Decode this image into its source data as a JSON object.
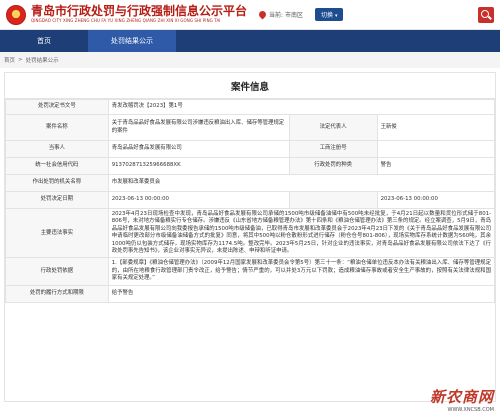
{
  "header": {
    "title": "青岛市行政处罚与行政强制信息公示平台",
    "subtitle": "QINGDAO CITY XING ZHENG CHU FA YU XING ZHENG QIANG ZHI XIN XI GONG SHI PING TAI",
    "location": "当前: 市南区",
    "switch_label": "切换"
  },
  "nav": {
    "items": [
      {
        "label": "首页"
      },
      {
        "label": "处罚结果公示"
      }
    ]
  },
  "breadcrumb": {
    "home": "首页",
    "current": "处罚结果公示"
  },
  "card": {
    "title": "案件信息",
    "labels": {
      "doc_number": "处罚决定书文号",
      "case_name": "案件名称",
      "legal_rep": "法定代表人",
      "party": "当事人",
      "business_reg": "工商注册号",
      "credit_code": "统一社会信用代码",
      "behavior_type": "行政处罚的种类",
      "authority": "作出处罚的机关名称",
      "decision_date": "处罚决定日期",
      "facts": "主要违法事实",
      "basis": "行政处罚依据",
      "fulfillment": "处罚的履行方式和期限"
    },
    "values": {
      "doc_number": "青发改稽罚决【2023】第1号",
      "case_name": "关于青岛品品好食品发展有限公司涉嫌违反粮油出入库、储存等管理规定的案件",
      "legal_rep": "王新俊",
      "party": "青岛品品好食品发展有限公司",
      "business_reg": "",
      "credit_code": "913702871325966688XK",
      "behavior_type": "警告",
      "authority": "市发展和改革委员会",
      "decision_date": "2023-06-13 00:00:00",
      "effective_date": "2023-06-13 00:00:00",
      "facts": "2023年4月23日现场检查中发现，青岛品品好食品发展有限公司承储的1500吨市级储备油储中有500吨未经批复，于4月21日起以数量和货位形式储于801-806号，未对地方储备粮实行专仓储存。涉嫌违反《山东省地方储备粮管理办法》第十四条和《粮油仓储管理办法》第三条的规定。经立案调查，5月9日，青岛品品好食品发展有限公司向我委报告承储的1500吨市级储备油，已取得青岛市发展和改革委员会于2023年4月23日下发的《关于青岛品品好食品发展有限公司申请临时更改部分市级储备油储备方式的批复》同意，将其中500吨以粉仓散粉形式进行储存（粉仓仓号801-806），现场实物库存系统计数据为560吨，其余1000吨仍以包装方式储存，现场实物库存为1174.5吨。整改完毕。2023年5月25日，针对企业的违法事实，对青岛品品好食品发展有限公司依法下达了《行政处罚事先告知书》，该企业对事实无异议，未提出陈述、申辩和听证申请。",
      "basis": "1.【部委规章】《粮油仓储管理办法》（2009年12月国家发展和改革委员会令第5号）第三十一条：“粮油仓储单位违反本办法有关粮油出入库、储存等管理规定的，由所在地粮食行政管理部门责令改正，给予警告；情节严重的，可以并处3万元以下罚款；造成粮油储存事故或者安全生产事故的，按照有关法律法规和国家有关规定处理。”",
      "fulfillment": "给予警告"
    }
  },
  "watermark": {
    "text": "新农商网",
    "url": "WWW.XNCSB.COM"
  },
  "colors": {
    "brand_red": "#b51d15",
    "nav_blue": "#1d3e77",
    "nav_active": "#2e5aa8"
  }
}
